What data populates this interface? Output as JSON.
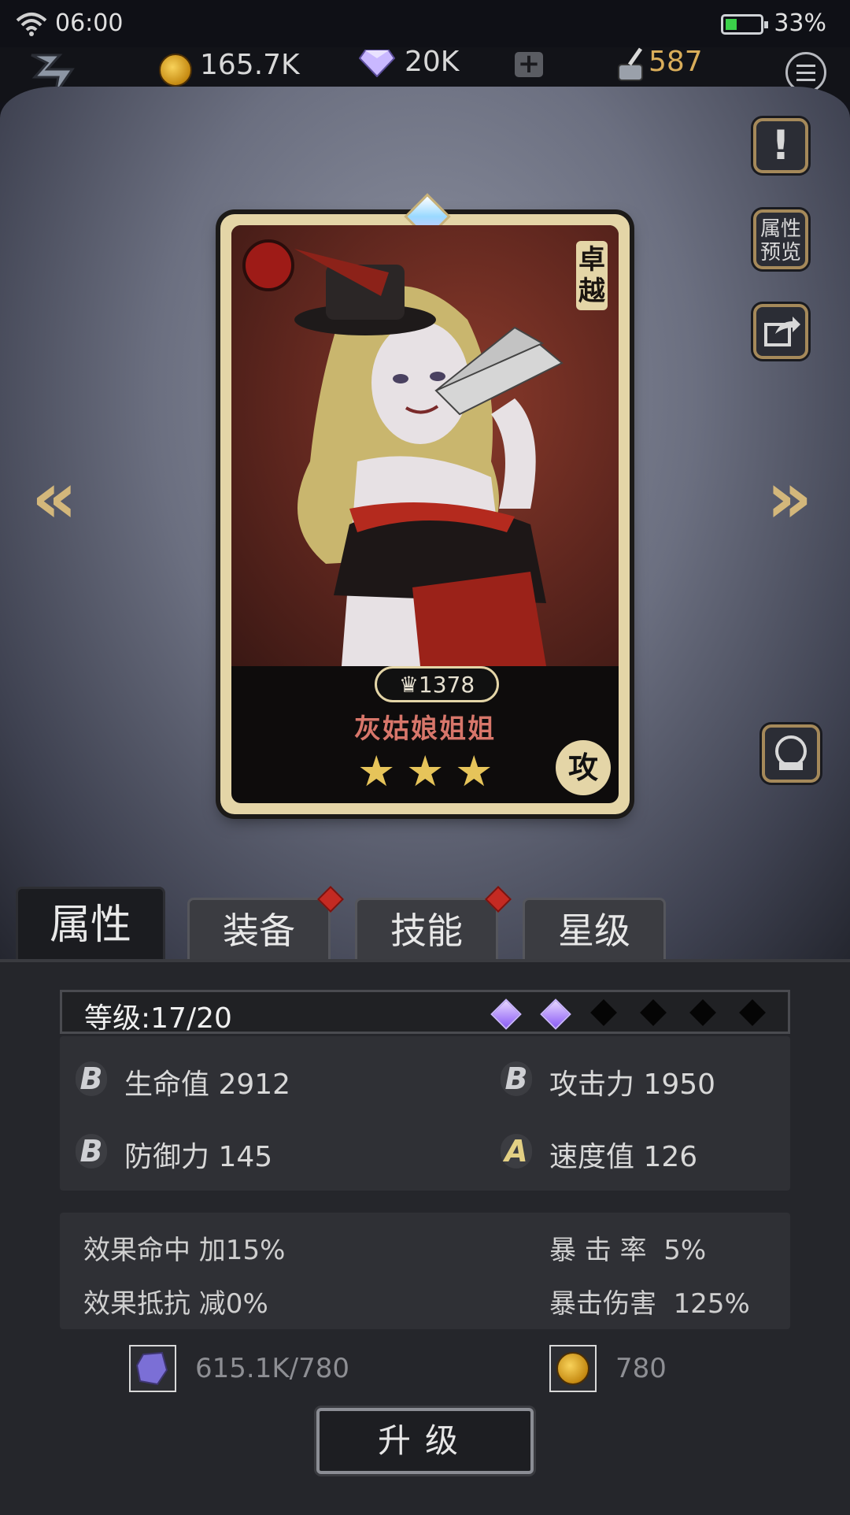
{
  "status_bar": {
    "time": "06:00",
    "battery_pct": "33%",
    "battery_level": 0.33
  },
  "resources": {
    "gold": "165.7K",
    "diamonds": "20K",
    "ink": "587"
  },
  "side_buttons": {
    "attr_preview": "属性\n预览"
  },
  "card": {
    "power": "1378",
    "name": "灰姑娘姐姐",
    "rank": "卓越",
    "role": "攻",
    "stars": 3
  },
  "tabs": [
    {
      "label": "属性",
      "active": true,
      "notify": false
    },
    {
      "label": "装备",
      "active": false,
      "notify": true
    },
    {
      "label": "技能",
      "active": false,
      "notify": true
    },
    {
      "label": "星级",
      "active": false,
      "notify": false
    }
  ],
  "level": {
    "text": "等级:17/20",
    "filled_slots": 2,
    "total_slots": 6
  },
  "stats": {
    "hp": {
      "grade": "B",
      "text": "生命值 2912"
    },
    "atk": {
      "grade": "B",
      "text": "攻击力 1950"
    },
    "def": {
      "grade": "B",
      "text": "防御力 145"
    },
    "spd": {
      "grade": "A",
      "text": "速度值 126"
    }
  },
  "substats": {
    "effect_hit": "效果命中 加15%",
    "crit_rate": "暴 击 率  5%",
    "effect_res": "效果抵抗 减0%",
    "crit_dmg": "暴击伤害  125%"
  },
  "cost": {
    "crystal": "615.1K/780",
    "gold": "780"
  },
  "upgrade_label": "升级",
  "colors": {
    "accent_gold": "#d3b77b",
    "panel": "#25262b",
    "card_frame": "#e4d5a7"
  }
}
